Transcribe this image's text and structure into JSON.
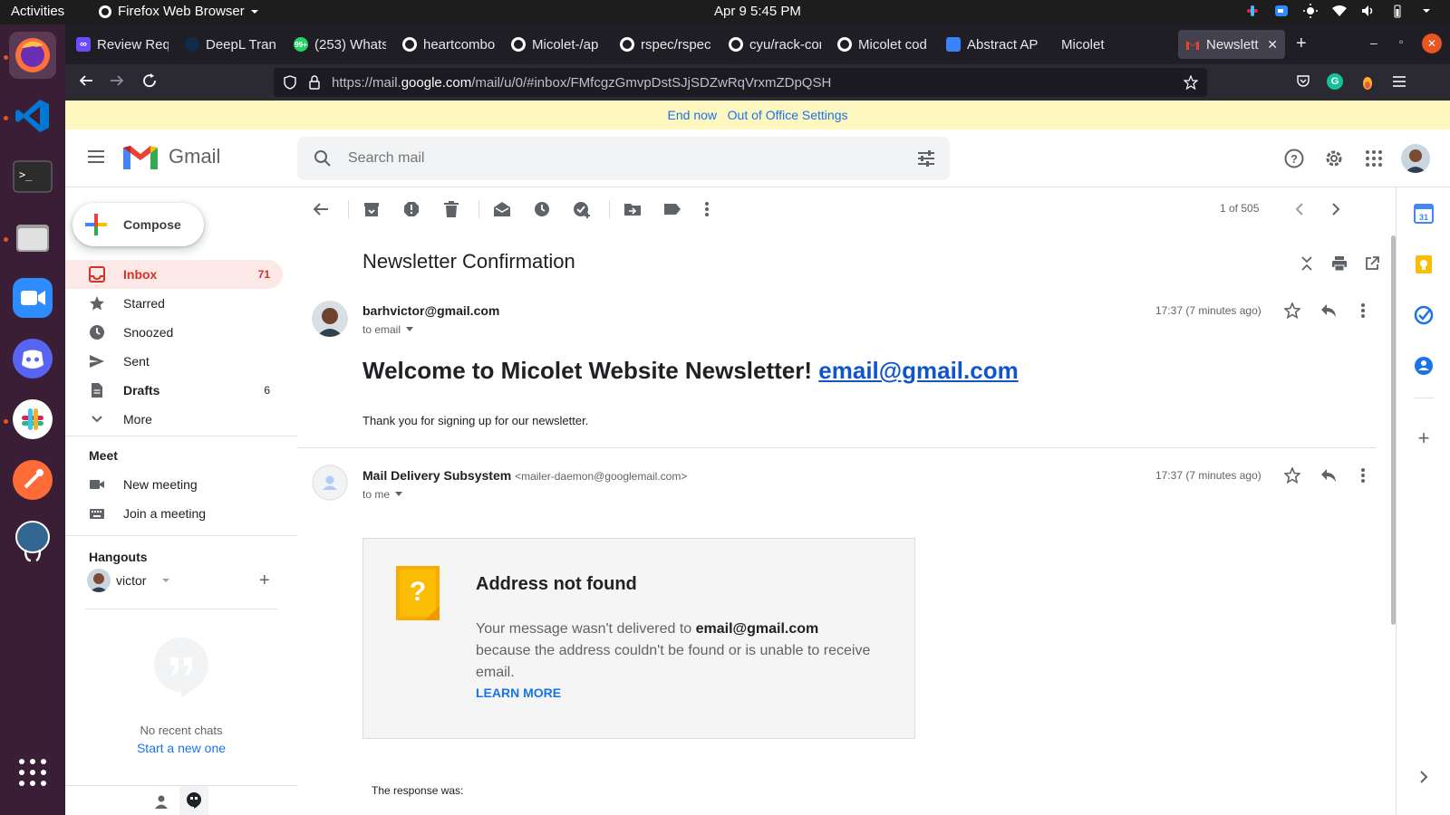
{
  "system": {
    "activities": "Activities",
    "app_menu": "Firefox Web Browser",
    "clock": "Apr 9  5:45 PM"
  },
  "browser": {
    "tabs": [
      {
        "label": "Review Req",
        "favicon_color": "#6d4aff"
      },
      {
        "label": "DeepL Tran",
        "favicon_color": "#0f2b46"
      },
      {
        "label": "(253) Whats",
        "favicon_color": "#25d366"
      },
      {
        "label": "heartcombo",
        "favicon_color": "#ffffff"
      },
      {
        "label": "Micolet-/ap",
        "favicon_color": "#ffffff"
      },
      {
        "label": "rspec/rspec",
        "favicon_color": "#ffffff"
      },
      {
        "label": "cyu/rack-cor",
        "favicon_color": "#ffffff"
      },
      {
        "label": "Micolet cod",
        "favicon_color": "#ffffff"
      },
      {
        "label": "Abstract AP",
        "favicon_color": "#3b82f6"
      },
      {
        "label": "Micolet",
        "favicon_color": ""
      },
      {
        "label": "Newslette",
        "favicon_color": "#ea4335"
      }
    ],
    "active_tab_index": 10,
    "url_prefix": "https://mail.",
    "url_domain": "google.com",
    "url_path": "/mail/u/0/#inbox/FMfcgzGmvpDstSJjSDZwRqVrxmZDpQSH"
  },
  "banner": {
    "end_now": "End now",
    "settings": "Out of Office Settings"
  },
  "gmail": {
    "product_name": "Gmail",
    "search_placeholder": "Search mail",
    "compose_label": "Compose",
    "nav": [
      {
        "label": "Inbox",
        "count": "71",
        "icon": "inbox-icon"
      },
      {
        "label": "Starred",
        "count": "",
        "icon": "star-icon"
      },
      {
        "label": "Snoozed",
        "count": "",
        "icon": "clock-icon"
      },
      {
        "label": "Sent",
        "count": "",
        "icon": "send-icon"
      },
      {
        "label": "Drafts",
        "count": "6",
        "icon": "draft-icon"
      },
      {
        "label": "More",
        "count": "",
        "icon": "chevron-down-icon"
      }
    ],
    "meet": {
      "heading": "Meet",
      "new_meeting": "New meeting",
      "join_meeting": "Join a meeting"
    },
    "hangouts": {
      "heading": "Hangouts",
      "user": "victor",
      "no_chats": "No recent chats",
      "start_new": "Start a new one"
    },
    "pagination": "1 of 505"
  },
  "thread": {
    "subject": "Newsletter Confirmation",
    "messages": [
      {
        "sender": "barhvictor@gmail.com",
        "sender_email": "",
        "to": "to email",
        "time": "17:37 (7 minutes ago)",
        "heading": "Welcome to Micolet Website Newsletter!",
        "heading_link": "email@gmail.com",
        "body": "Thank you for signing up for our newsletter."
      },
      {
        "sender": "Mail Delivery Subsystem",
        "sender_email": "<mailer-daemon@googlemail.com>",
        "to": "to me",
        "time": "17:37 (7 minutes ago)"
      }
    ],
    "bounce": {
      "title": "Address not found",
      "text_before": "Your message wasn't delivered to ",
      "address": "email@gmail.com",
      "text_after": " because the address couldn't be found or is unable to receive email.",
      "learn_more": "LEARN MORE",
      "response_label": "The response was:"
    }
  },
  "colors": {
    "gmail_red": "#d93025",
    "link_blue": "#1a73e8",
    "banner_yellow": "#fef7c0",
    "dock_bg": "#3a1e35"
  }
}
